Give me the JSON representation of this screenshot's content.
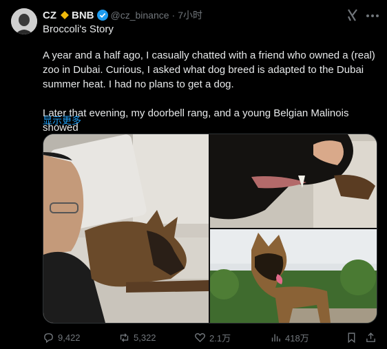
{
  "author": {
    "name": "CZ",
    "badge": "BNB",
    "handle": "@cz_binance",
    "separator": "·",
    "time": "7小时"
  },
  "post": {
    "title": "Broccoli's Story",
    "paragraph1": "A year and a half ago, I casually chatted with a friend who owned a (real) zoo in Dubai. Curious, I asked what dog breed is adapted to the Dubai summer heat. I had no plans to get a dog.",
    "paragraph2": "Later that evening, my doorbell rang, and a young Belgian Malinois showed",
    "show_more": "显示更多"
  },
  "media": [
    {
      "name": "photo-man-with-puppy"
    },
    {
      "name": "photo-dog-teeth-closeup"
    },
    {
      "name": "photo-dog-in-garden"
    }
  ],
  "actions": {
    "replies": "9,422",
    "reposts": "5,322",
    "likes": "2.1万",
    "views": "418万"
  },
  "colors": {
    "background": "#000000",
    "text": "#e7e9ea",
    "muted": "#71767b",
    "link": "#1d9bf0",
    "bnb": "#f0b90b"
  }
}
